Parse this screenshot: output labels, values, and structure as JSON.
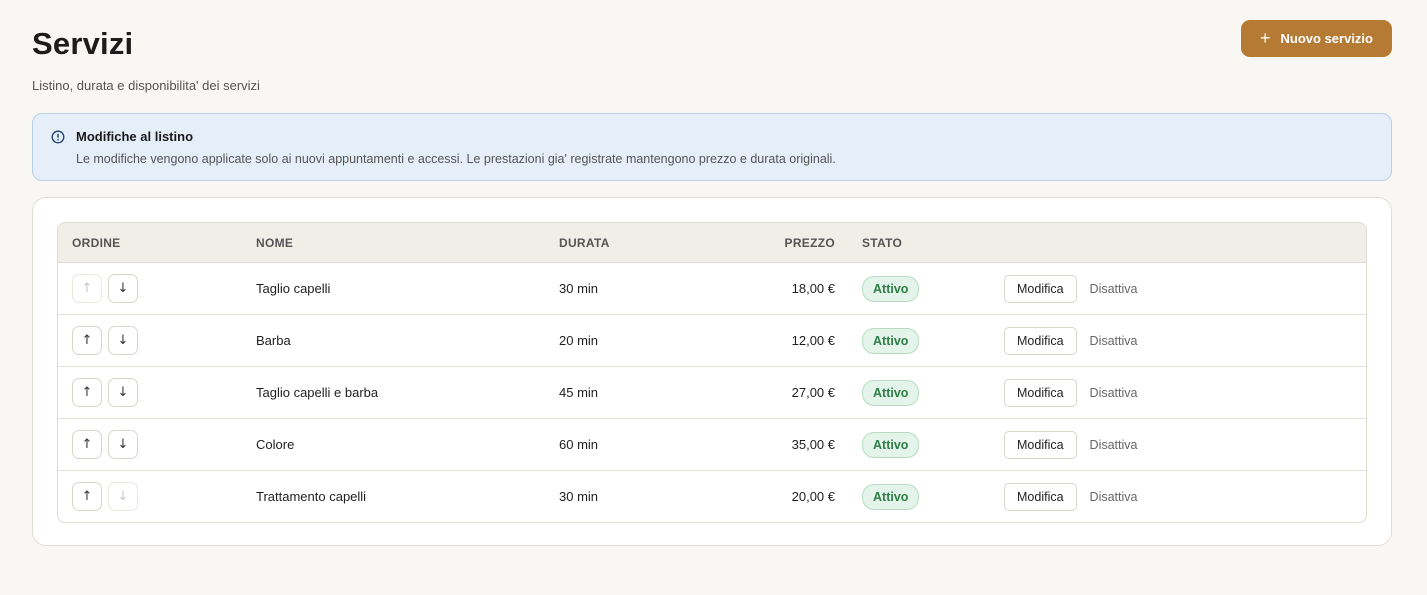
{
  "header": {
    "title": "Servizi",
    "subtitle": "Listino, durata e disponibilita' dei servizi",
    "new_button_label": "Nuovo servizio"
  },
  "notice": {
    "title": "Modifiche al listino",
    "text": "Le modifiche vengono applicate solo ai nuovi appuntamenti e accessi. Le prestazioni gia' registrate mantengono prezzo e durata originali."
  },
  "table": {
    "columns": {
      "ordine": "ORDINE",
      "nome": "NOME",
      "durata": "DURATA",
      "prezzo": "PREZZO",
      "stato": "STATO"
    },
    "rows": [
      {
        "nome": "Taglio capelli",
        "durata": "30 min",
        "prezzo": "18,00 €",
        "stato": "Attivo",
        "up_disabled": true,
        "down_disabled": false
      },
      {
        "nome": "Barba",
        "durata": "20 min",
        "prezzo": "12,00 €",
        "stato": "Attivo",
        "up_disabled": false,
        "down_disabled": false
      },
      {
        "nome": "Taglio capelli e barba",
        "durata": "45 min",
        "prezzo": "27,00 €",
        "stato": "Attivo",
        "up_disabled": false,
        "down_disabled": false
      },
      {
        "nome": "Colore",
        "durata": "60 min",
        "prezzo": "35,00 €",
        "stato": "Attivo",
        "up_disabled": false,
        "down_disabled": false
      },
      {
        "nome": "Trattamento capelli",
        "durata": "30 min",
        "prezzo": "20,00 €",
        "stato": "Attivo",
        "up_disabled": false,
        "down_disabled": true
      }
    ],
    "edit_label": "Modifica",
    "deactivate_label": "Disattiva",
    "up_icon": "↑",
    "down_icon": "↓"
  },
  "colors": {
    "accent": "#b57a33",
    "background": "#f9f7f3",
    "notice_bg": "#e6eff9",
    "status_active": "#2e7d46"
  }
}
